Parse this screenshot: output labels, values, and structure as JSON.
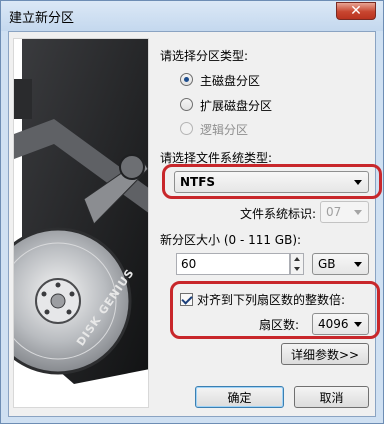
{
  "window": {
    "title": "建立新分区",
    "close_glyph": "✕"
  },
  "partition_type": {
    "label": "请选择分区类型:",
    "options": [
      {
        "label": "主磁盘分区",
        "selected": true,
        "enabled": true
      },
      {
        "label": "扩展磁盘分区",
        "selected": false,
        "enabled": true
      },
      {
        "label": "逻辑分区",
        "selected": false,
        "enabled": false
      }
    ]
  },
  "filesystem": {
    "label": "请选择文件系统类型:",
    "selected": "NTFS",
    "id_label": "文件系统标识:",
    "id_value": "07"
  },
  "size": {
    "label": "新分区大小 (0 - 111 GB):",
    "value": "60",
    "unit": "GB"
  },
  "align": {
    "checkbox_label": "对齐到下列扇区数的整数倍:",
    "checked": true,
    "sectors_label": "扇区数:",
    "sectors_value": "4096"
  },
  "buttons": {
    "advanced": "详细参数>>",
    "ok": "确定",
    "cancel": "取消"
  },
  "brand": {
    "disk_text": "DISK GENIUS"
  },
  "colors": {
    "highlight": "#c8272b",
    "title_bg": "#cfe0f2"
  }
}
